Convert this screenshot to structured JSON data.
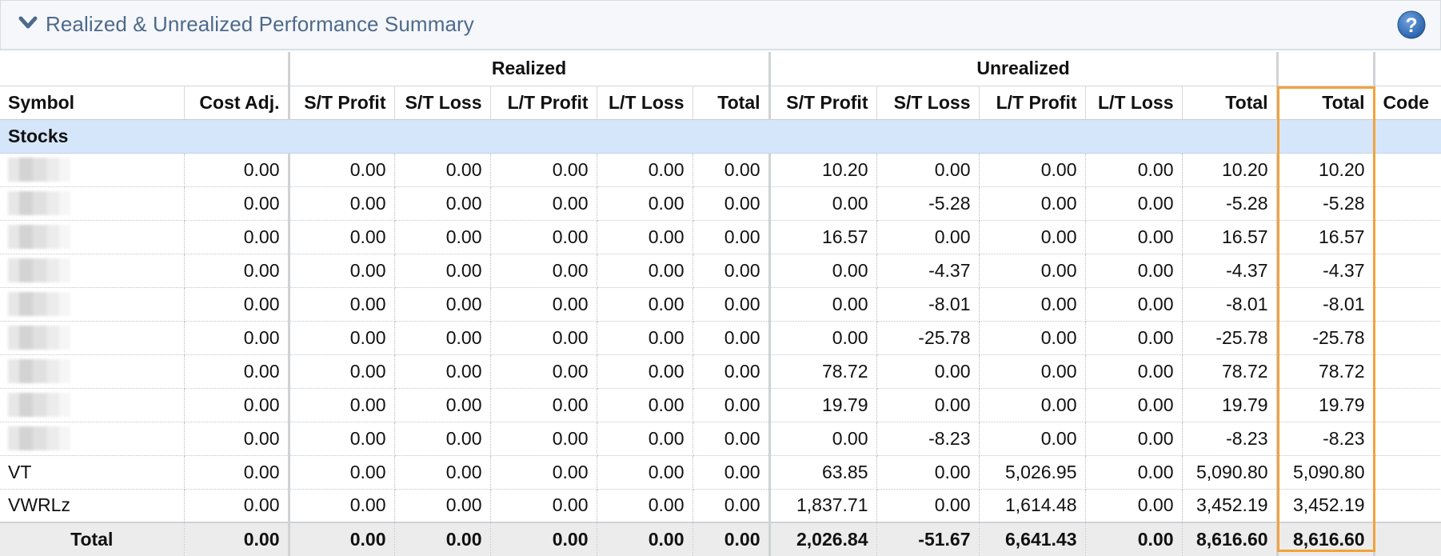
{
  "panel": {
    "title": "Realized & Unrealized Performance Summary"
  },
  "icons": {
    "collapse": "chevron-down-icon",
    "help": "help-icon"
  },
  "colors": {
    "title": "#4e6a8c",
    "section_bg": "#d5e6fb",
    "highlight": "#f2a33a",
    "help_icon": "#2e6db6"
  },
  "groups": {
    "realized": "Realized",
    "unrealized": "Unrealized"
  },
  "columns": [
    "Symbol",
    "Cost Adj.",
    "S/T Profit",
    "S/T Loss",
    "L/T Profit",
    "L/T Loss",
    "Total",
    "S/T Profit",
    "S/T Loss",
    "L/T Profit",
    "L/T Loss",
    "Total",
    "Total",
    "Code"
  ],
  "section": {
    "label": "Stocks"
  },
  "rows": [
    {
      "symbol": "",
      "values": [
        "0.00",
        "0.00",
        "0.00",
        "0.00",
        "0.00",
        "0.00",
        "10.20",
        "0.00",
        "0.00",
        "0.00",
        "10.20",
        "10.20",
        ""
      ]
    },
    {
      "symbol": "",
      "values": [
        "0.00",
        "0.00",
        "0.00",
        "0.00",
        "0.00",
        "0.00",
        "0.00",
        "-5.28",
        "0.00",
        "0.00",
        "-5.28",
        "-5.28",
        ""
      ]
    },
    {
      "symbol": "",
      "values": [
        "0.00",
        "0.00",
        "0.00",
        "0.00",
        "0.00",
        "0.00",
        "16.57",
        "0.00",
        "0.00",
        "0.00",
        "16.57",
        "16.57",
        ""
      ]
    },
    {
      "symbol": "",
      "values": [
        "0.00",
        "0.00",
        "0.00",
        "0.00",
        "0.00",
        "0.00",
        "0.00",
        "-4.37",
        "0.00",
        "0.00",
        "-4.37",
        "-4.37",
        ""
      ]
    },
    {
      "symbol": "",
      "values": [
        "0.00",
        "0.00",
        "0.00",
        "0.00",
        "0.00",
        "0.00",
        "0.00",
        "-8.01",
        "0.00",
        "0.00",
        "-8.01",
        "-8.01",
        ""
      ]
    },
    {
      "symbol": "",
      "values": [
        "0.00",
        "0.00",
        "0.00",
        "0.00",
        "0.00",
        "0.00",
        "0.00",
        "-25.78",
        "0.00",
        "0.00",
        "-25.78",
        "-25.78",
        ""
      ]
    },
    {
      "symbol": "",
      "values": [
        "0.00",
        "0.00",
        "0.00",
        "0.00",
        "0.00",
        "0.00",
        "78.72",
        "0.00",
        "0.00",
        "0.00",
        "78.72",
        "78.72",
        ""
      ]
    },
    {
      "symbol": "",
      "values": [
        "0.00",
        "0.00",
        "0.00",
        "0.00",
        "0.00",
        "0.00",
        "19.79",
        "0.00",
        "0.00",
        "0.00",
        "19.79",
        "19.79",
        ""
      ]
    },
    {
      "symbol": "",
      "values": [
        "0.00",
        "0.00",
        "0.00",
        "0.00",
        "0.00",
        "0.00",
        "0.00",
        "-8.23",
        "0.00",
        "0.00",
        "-8.23",
        "-8.23",
        ""
      ]
    },
    {
      "symbol": "VT",
      "values": [
        "0.00",
        "0.00",
        "0.00",
        "0.00",
        "0.00",
        "0.00",
        "63.85",
        "0.00",
        "5,026.95",
        "0.00",
        "5,090.80",
        "5,090.80",
        ""
      ]
    },
    {
      "symbol": "VWRLz",
      "values": [
        "0.00",
        "0.00",
        "0.00",
        "0.00",
        "0.00",
        "0.00",
        "1,837.71",
        "0.00",
        "1,614.48",
        "0.00",
        "3,452.19",
        "3,452.19",
        ""
      ]
    }
  ],
  "total": {
    "label": "Total",
    "values": [
      "0.00",
      "0.00",
      "0.00",
      "0.00",
      "0.00",
      "0.00",
      "2,026.84",
      "-51.67",
      "6,641.43",
      "0.00",
      "8,616.60",
      "8,616.60",
      ""
    ]
  }
}
